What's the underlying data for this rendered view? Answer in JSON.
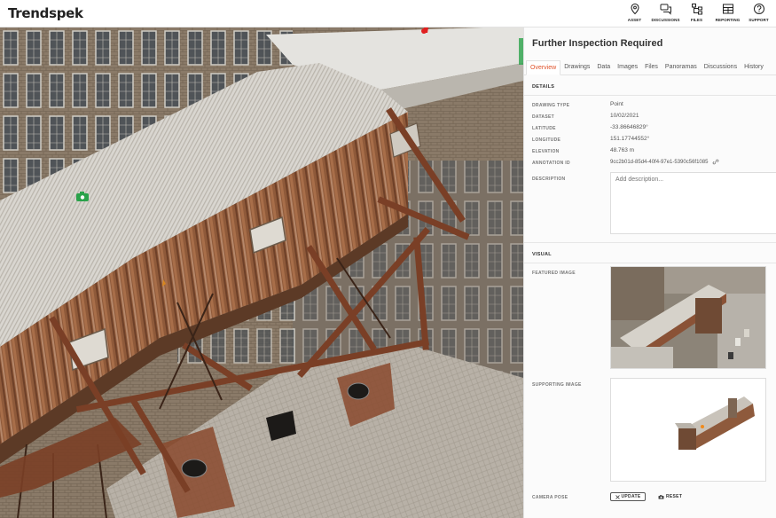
{
  "app": {
    "logo": "Trendspek"
  },
  "nav": [
    {
      "label": "ASSET",
      "icon": "map-pin-icon"
    },
    {
      "label": "DISCUSSIONS",
      "icon": "chat-bubbles-icon"
    },
    {
      "label": "FILES",
      "icon": "folder-tree-icon"
    },
    {
      "label": "REPORTING",
      "icon": "report-table-icon"
    },
    {
      "label": "SUPPORT",
      "icon": "help-circle-icon"
    }
  ],
  "viewport": {
    "markers": [
      {
        "icon": "camera-marker-icon",
        "color": "#2aa24a"
      },
      {
        "icon": "pin-marker-icon",
        "color": "#e02020"
      }
    ]
  },
  "panel": {
    "title": "Further Inspection Required",
    "tabs": [
      "Overview",
      "Drawings",
      "Data",
      "Images",
      "Files",
      "Panoramas",
      "Discussions",
      "History"
    ],
    "active_tab": "Overview",
    "accent_color": "#e0522a",
    "details": {
      "heading": "DETAILS",
      "fields": [
        {
          "label": "DRAWING TYPE",
          "value": "Point"
        },
        {
          "label": "DATASET",
          "value": "10/02/2021"
        },
        {
          "label": "LATITUDE",
          "value": "-33.86646829°"
        },
        {
          "label": "LONGITUDE",
          "value": "151.17744552°"
        },
        {
          "label": "ELEVATION",
          "value": "48.763 m"
        },
        {
          "label": "ANNOTATION ID",
          "value": "9cc2b01d-85d4-40f4-97e1-5390c56f1085"
        }
      ],
      "description_label": "DESCRIPTION",
      "description_placeholder": "Add description..."
    },
    "visual": {
      "heading": "VISUAL",
      "featured_label": "FEATURED IMAGE",
      "supporting_label": "SUPPORTING IMAGE",
      "camera_label": "CAMERA POSE",
      "update_label": "UPDATE",
      "reset_label": "RESET"
    }
  }
}
